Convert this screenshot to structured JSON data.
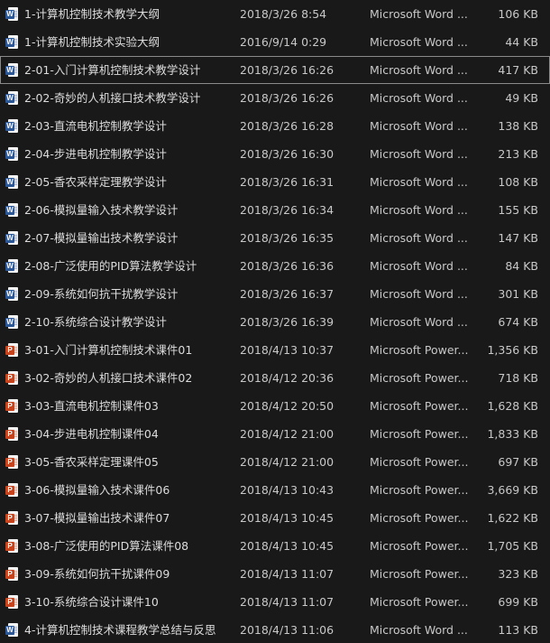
{
  "colors": {
    "background": "#191919",
    "text": "#dcdcdc",
    "word_badge": "#2b5797",
    "powerpoint_badge": "#c8421b",
    "selection_border": "#8a8a8a"
  },
  "selected_index": 2,
  "files": [
    {
      "icon": "word-doc-icon",
      "name": "1-计算机控制技术教学大纲",
      "modified": "2018/3/26 8:54",
      "type": "Microsoft Word ...",
      "size": "106 KB"
    },
    {
      "icon": "word-doc-icon",
      "name": "1-计算机控制技术实验大纲",
      "modified": "2016/9/14 0:29",
      "type": "Microsoft Word ...",
      "size": "44 KB"
    },
    {
      "icon": "word-doc-icon",
      "name": "2-01-入门计算机控制技术教学设计",
      "modified": "2018/3/26 16:26",
      "type": "Microsoft Word ...",
      "size": "417 KB"
    },
    {
      "icon": "word-doc-icon",
      "name": "2-02-奇妙的人机接口技术教学设计",
      "modified": "2018/3/26 16:26",
      "type": "Microsoft Word ...",
      "size": "49 KB"
    },
    {
      "icon": "word-doc-icon",
      "name": "2-03-直流电机控制教学设计",
      "modified": "2018/3/26 16:28",
      "type": "Microsoft Word ...",
      "size": "138 KB"
    },
    {
      "icon": "word-doc-icon",
      "name": "2-04-步进电机控制教学设计",
      "modified": "2018/3/26 16:30",
      "type": "Microsoft Word ...",
      "size": "213 KB"
    },
    {
      "icon": "word-doc-icon",
      "name": "2-05-香农采样定理教学设计",
      "modified": "2018/3/26 16:31",
      "type": "Microsoft Word ...",
      "size": "108 KB"
    },
    {
      "icon": "word-doc-icon",
      "name": "2-06-模拟量输入技术教学设计",
      "modified": "2018/3/26 16:34",
      "type": "Microsoft Word ...",
      "size": "155 KB"
    },
    {
      "icon": "word-doc-icon",
      "name": "2-07-模拟量输出技术教学设计",
      "modified": "2018/3/26 16:35",
      "type": "Microsoft Word ...",
      "size": "147 KB"
    },
    {
      "icon": "word-doc-icon",
      "name": "2-08-广泛使用的PID算法教学设计",
      "modified": "2018/3/26 16:36",
      "type": "Microsoft Word ...",
      "size": "84 KB"
    },
    {
      "icon": "word-doc-icon",
      "name": "2-09-系统如何抗干扰教学设计",
      "modified": "2018/3/26 16:37",
      "type": "Microsoft Word ...",
      "size": "301 KB"
    },
    {
      "icon": "word-doc-icon",
      "name": "2-10-系统综合设计教学设计",
      "modified": "2018/3/26 16:39",
      "type": "Microsoft Word ...",
      "size": "674 KB"
    },
    {
      "icon": "powerpoint-doc-icon",
      "name": "3-01-入门计算机控制技术课件01",
      "modified": "2018/4/13 10:37",
      "type": "Microsoft Power...",
      "size": "1,356 KB"
    },
    {
      "icon": "powerpoint-doc-icon",
      "name": "3-02-奇妙的人机接口技术课件02",
      "modified": "2018/4/12 20:36",
      "type": "Microsoft Power...",
      "size": "718 KB"
    },
    {
      "icon": "powerpoint-doc-icon",
      "name": "3-03-直流电机控制课件03",
      "modified": "2018/4/12 20:50",
      "type": "Microsoft Power...",
      "size": "1,628 KB"
    },
    {
      "icon": "powerpoint-doc-icon",
      "name": "3-04-步进电机控制课件04",
      "modified": "2018/4/12 21:00",
      "type": "Microsoft Power...",
      "size": "1,833 KB"
    },
    {
      "icon": "powerpoint-doc-icon",
      "name": "3-05-香农采样定理课件05",
      "modified": "2018/4/12 21:00",
      "type": "Microsoft Power...",
      "size": "697 KB"
    },
    {
      "icon": "powerpoint-doc-icon",
      "name": "3-06-模拟量输入技术课件06",
      "modified": "2018/4/13 10:43",
      "type": "Microsoft Power...",
      "size": "3,669 KB"
    },
    {
      "icon": "powerpoint-doc-icon",
      "name": "3-07-模拟量输出技术课件07",
      "modified": "2018/4/13 10:45",
      "type": "Microsoft Power...",
      "size": "1,622 KB"
    },
    {
      "icon": "powerpoint-doc-icon",
      "name": "3-08-广泛使用的PID算法课件08",
      "modified": "2018/4/13 10:45",
      "type": "Microsoft Power...",
      "size": "1,705 KB"
    },
    {
      "icon": "powerpoint-doc-icon",
      "name": "3-09-系统如何抗干扰课件09",
      "modified": "2018/4/13 11:07",
      "type": "Microsoft Power...",
      "size": "323 KB"
    },
    {
      "icon": "powerpoint-doc-icon",
      "name": "3-10-系统综合设计课件10",
      "modified": "2018/4/13 11:07",
      "type": "Microsoft Power...",
      "size": "699 KB"
    },
    {
      "icon": "word-doc-icon",
      "name": "4-计算机控制技术课程教学总结与反思",
      "modified": "2018/4/13 11:06",
      "type": "Microsoft Word ...",
      "size": "113 KB"
    }
  ]
}
